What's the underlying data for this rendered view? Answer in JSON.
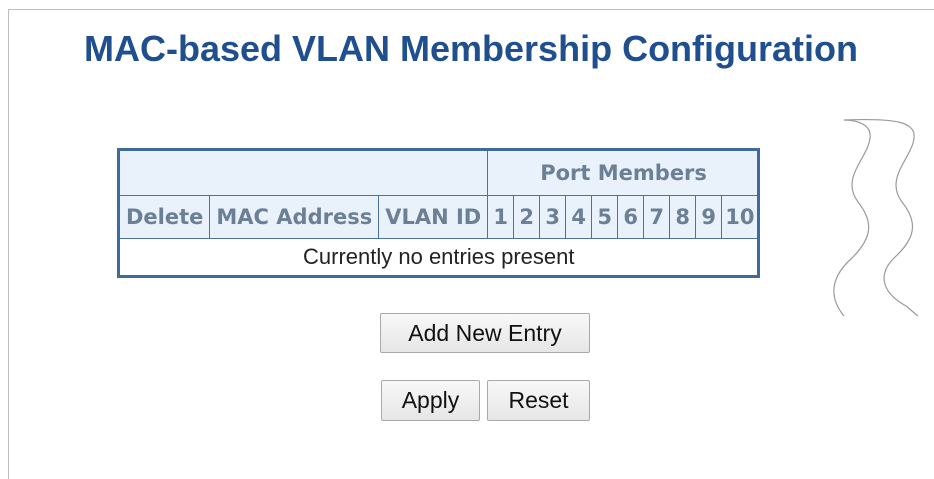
{
  "page_title": "MAC-based VLAN Membership Configuration",
  "table": {
    "group_header": "Port Members",
    "columns": {
      "delete": "Delete",
      "mac_address": "MAC Address",
      "vlan_id": "VLAN ID"
    },
    "ports": [
      "1",
      "2",
      "3",
      "4",
      "5",
      "6",
      "7",
      "8",
      "9",
      "10"
    ],
    "empty_message": "Currently no entries present"
  },
  "buttons": {
    "add_new_entry": "Add New Entry",
    "apply": "Apply",
    "reset": "Reset"
  },
  "colors": {
    "title": "#1f4f8f",
    "header_bg": "#e9f1fb",
    "header_text": "#6b7f95",
    "table_border": "#3f6a9a"
  }
}
